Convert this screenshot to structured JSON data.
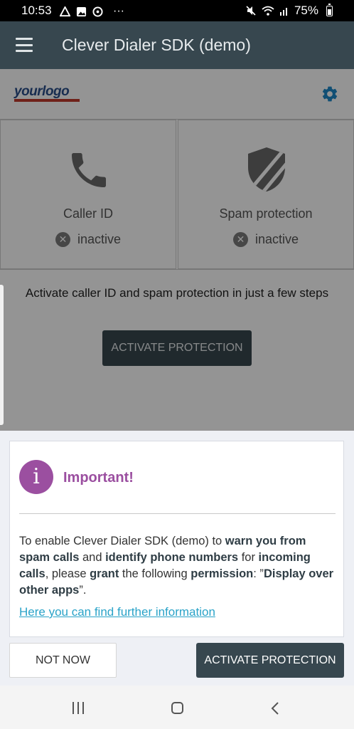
{
  "status_bar": {
    "time": "10:53",
    "battery": "75%",
    "icons": [
      "drive-icon",
      "gallery-icon",
      "messenger-icon",
      "more-dots-icon",
      "mute-icon",
      "wifi-icon",
      "signal-icon",
      "battery-icon"
    ],
    "more_dots": "···"
  },
  "app_bar": {
    "title": "Clever Dialer SDK (demo)",
    "menu_icon": "hamburger-menu-icon"
  },
  "header": {
    "logo_text": "yourlogo",
    "settings_icon": "gear-icon",
    "accent_color": "#1e88c8"
  },
  "cards": [
    {
      "icon": "phone-icon",
      "label": "Caller ID",
      "status": "inactive"
    },
    {
      "icon": "shield-icon",
      "label": "Spam protection",
      "status": "inactive"
    }
  ],
  "promo": {
    "text": "Activate caller ID and spam protection in just a few steps",
    "button": "ACTIVATE PROTECTION"
  },
  "dialog": {
    "title": "Important!",
    "title_color": "#9b4fa0",
    "message": {
      "p1": "To enable Clever Dialer SDK (demo) to ",
      "b1": "warn you from spam calls",
      "p2": " and ",
      "b2": "identify phone numbers",
      "p3": " for ",
      "b3": "incoming calls",
      "p4": ", please ",
      "b4": "grant",
      "p5": " the following ",
      "b5": "permission",
      "p6": ": ”",
      "b6": "Display over other apps",
      "p7": "”."
    },
    "link": "Here you can find further information",
    "link_color": "#2aa3c8"
  },
  "actions": {
    "not_now": "NOT NOW",
    "activate": "ACTIVATE PROTECTION"
  },
  "nav_bar": {
    "icons": [
      "recent-apps-icon",
      "home-icon",
      "back-icon"
    ]
  }
}
